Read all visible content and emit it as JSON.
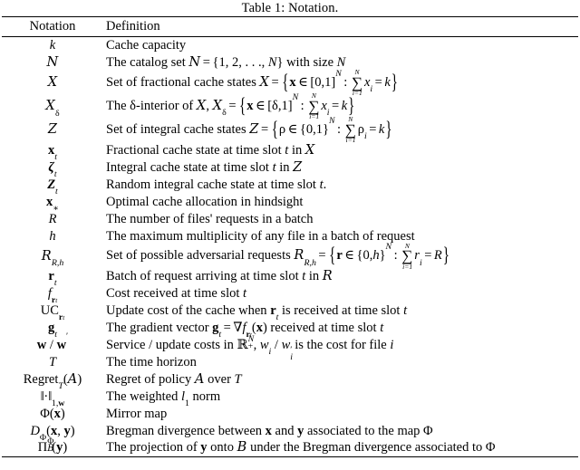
{
  "caption": {
    "label": "Table 1:",
    "text": "Notation.",
    "full": "Table 1: Notation."
  },
  "table": {
    "columns": [
      "Notation",
      "Definition"
    ],
    "rows": [
      {
        "notation": "k",
        "definition": "Cache capacity"
      },
      {
        "notation": "N",
        "definition": "The catalog set N = {1, 2, . . . , N} with size N"
      },
      {
        "notation": "X",
        "definition": "Set of fractional cache states X = { x ∈ [0,1]^N : sum_{i=1}^{N} x_i = k }"
      },
      {
        "notation": "X_delta",
        "definition": "The δ-interior of X, X_δ = { x ∈ [δ,1]^N : sum_{i=1}^{N} x_i = k }"
      },
      {
        "notation": "Z",
        "definition": "Set of integral cache states Z = { ρ ∈ {0,1}^N : sum_{i=1}^{N} ρ_i = k }"
      },
      {
        "notation": "x_t",
        "definition": "Fractional cache state at time slot t in X"
      },
      {
        "notation": "zeta_t",
        "definition": "Integral cache state at time slot t in Z"
      },
      {
        "notation": "Z_t",
        "definition": "Random integral cache state at time slot t."
      },
      {
        "notation": "x_*",
        "definition": "Optimal cache allocation in hindsight"
      },
      {
        "notation": "R",
        "definition": "The number of files' requests in a batch"
      },
      {
        "notation": "h",
        "definition": "The maximum multiplicity of any file in a batch of request"
      },
      {
        "notation": "R_{R,h}",
        "definition": "Set of possible adversarial requests R_{R,h} = { r ∈ {0,h}^N : sum_{i=1}^{N} r_i = R }"
      },
      {
        "notation": "r_t",
        "definition": "Batch of request arriving at time slot t in R"
      },
      {
        "notation": "f_{r_t}",
        "definition": "Cost received at time slot t"
      },
      {
        "notation": "UC_{r_t}",
        "definition": "Update cost of the cache when r_t is received at time slot t"
      },
      {
        "notation": "g_t",
        "definition": "The gradient vector g_t = ∇f_{r_t}(x) received at time slot t"
      },
      {
        "notation": "w / w'",
        "definition": "Service / update costs in R_+^N, w_i / w'_i is the cost for file i"
      },
      {
        "notation": "T",
        "definition": "The time horizon"
      },
      {
        "notation": "Regret_T(A)",
        "definition": "Regret of policy A over T"
      },
      {
        "notation": "||.||_{1,w}",
        "definition": "The weighted l_1 norm"
      },
      {
        "notation": "Phi(x)",
        "definition": "Mirror map"
      },
      {
        "notation": "D_Phi(x, y)",
        "definition": "Bregman divergence between x and y associated to the map Φ"
      },
      {
        "notation": "Pi_B^Phi(y)",
        "definition": "The projection of y onto B under the Bregman divergence associated to Φ"
      }
    ]
  },
  "text": {
    "cache_capacity": "Cache capacity",
    "the_catalog_set": "The catalog set",
    "with_size": "with size",
    "set_of_fractional": "Set of fractional cache states",
    "the": "The",
    "interior_of": "-interior of",
    "set_of_integral": "Set of integral cache states",
    "fractional_state": "Fractional cache state at time slot",
    "integral_state": "Integral cache state at time slot",
    "random_state": "Random integral cache state at time slot",
    "in": "in",
    "optimal_alloc": "Optimal cache allocation in hindsight",
    "num_requests": "The number of files' requests in a batch",
    "max_multiplicity": "The maximum multiplicity of any file in a batch of request",
    "set_adversarial": "Set of possible adversarial requests",
    "batch_arriving": "Batch of request arriving at time slot",
    "cost_received": "Cost received at time slot",
    "update_cost_a": "Update cost of the cache when",
    "update_cost_b": "is received at time slot",
    "gradient_a": "The gradient vector",
    "gradient_b": "received at time slot",
    "service_update_a": "Service / update costs in",
    "service_update_b": "is the cost for file",
    "time_horizon": "The time horizon",
    "regret_of_policy": "Regret of policy",
    "over": "over",
    "weighted_norm_a": "The weighted",
    "weighted_norm_b": "norm",
    "mirror_map": "Mirror map",
    "bregman_a": "Bregman divergence between",
    "bregman_and": "and",
    "bregman_b": "associated to the map",
    "projection_a": "The projection of",
    "projection_onto": "onto",
    "projection_b": "under the Bregman divergence associated to"
  },
  "symbols": {
    "k": "k",
    "N": "N",
    "t": "t",
    "T": "T",
    "R": "R",
    "h": "h",
    "i": "i",
    "x": "x",
    "y": "y",
    "w": "w",
    "r": "r",
    "g": "g",
    "f": "f",
    "D": "D",
    "l": "l",
    "one": "1",
    "zero": "0",
    "two": "2",
    "delta": "δ",
    "rho": "ρ",
    "zeta": "ζ",
    "Phi": "Φ",
    "Pi": "Π",
    "nabla": "∇",
    "in_set": "∈",
    "equals": "=",
    "colon": ":",
    "comma": ",",
    "dots": ". . .",
    "slash": "/",
    "period": ".",
    "prime": "′",
    "plus": "+",
    "star": "∗",
    "cdot": "·",
    "lbrace": "{",
    "rbrace": "}",
    "lbrack": "[",
    "rbrack": "]",
    "lparen": "(",
    "rparen": ")",
    "sum": "∑",
    "norm_bar": "‖",
    "cal_N": "N",
    "cal_X": "X",
    "cal_Z": "Z",
    "cal_R": "R",
    "cal_A": "A",
    "cal_B": "B",
    "bb_R": "ℝ",
    "Regret": "Regret",
    "UC": "UC"
  },
  "colors": {
    "background": "#ffffff",
    "text": "#000000",
    "rule": "#000000"
  }
}
